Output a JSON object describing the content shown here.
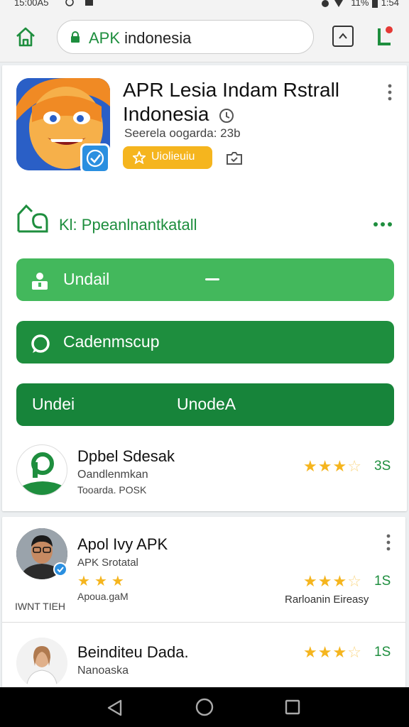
{
  "status_bar": {
    "time_left": "15:00A5",
    "battery_text": "11%",
    "time_right": "1:54"
  },
  "address_bar": {
    "url_prefix": "APK",
    "url_rest": " indonesia"
  },
  "app": {
    "title": "APR Lesia Indam Rstrall Indonesia",
    "subtitle": "Seerela oogarda: 23b",
    "badge_label": "Uiolieuiu"
  },
  "section": {
    "title": "Kl: Ppeanlnantkatall"
  },
  "actions": {
    "primary_label": "Undail",
    "secondary_label": "Cadenmscup",
    "combo_left": "Undei",
    "combo_right": "UnodeA"
  },
  "list_items": [
    {
      "name": "Dpbel Sdesak",
      "line1": "Oandlenmkan",
      "line2": "Tooarda. POSK",
      "rating": 3.5,
      "score": "3S"
    },
    {
      "name": "Apol Ivy APK",
      "line1": "APK Srotatal",
      "line2": "Apoua.gaM",
      "rating": 3.5,
      "score": "1S",
      "mini_rating": 3,
      "tag_left": "IWNT TIEH",
      "tag_right": "Rarloanin Eireasy"
    },
    {
      "name": "Beinditeu Dada.",
      "line1": "Nanoaska",
      "rating": 3,
      "score": "1S"
    }
  ],
  "icons": {
    "home": "home-icon",
    "lock": "lock-icon",
    "tabs": "tab-switcher-icon",
    "menu": "browser-menu-icon",
    "verified": "verified-check-icon",
    "clock": "clock-icon",
    "star": "star-icon",
    "save": "save-icon",
    "section": "house-leaf-icon",
    "person": "person-icon",
    "chat": "chat-bubble-icon",
    "back": "back-icon",
    "nav_home": "nav-home-icon",
    "recents": "recents-icon",
    "more": "more-dots-icon"
  },
  "colors": {
    "accent_green": "#1e8e3e",
    "light_green": "#43b85c",
    "badge_yellow": "#f5b51e",
    "verified_blue": "#2a8fe0"
  }
}
